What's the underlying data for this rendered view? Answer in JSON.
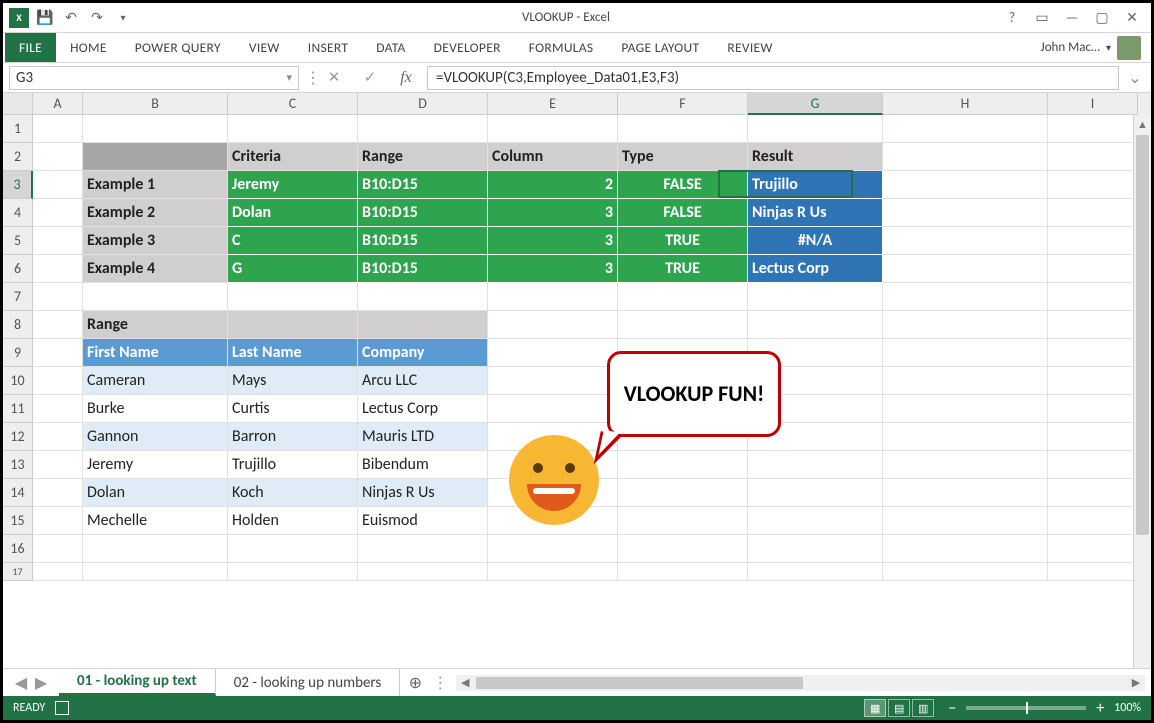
{
  "title": "VLOOKUP - Excel",
  "ribbon": {
    "file": "FILE",
    "tabs": [
      "HOME",
      "POWER QUERY",
      "VIEW",
      "INSERT",
      "DATA",
      "DEVELOPER",
      "FORMULAS",
      "PAGE LAYOUT",
      "REVIEW"
    ]
  },
  "user": "John Mac…",
  "namebox": "G3",
  "formula": "=VLOOKUP(C3,Employee_Data01,E3,F3)",
  "colHeaders": [
    "A",
    "B",
    "C",
    "D",
    "E",
    "F",
    "G",
    "H",
    "I"
  ],
  "activeCol": "G",
  "activeRow": 3,
  "headers2": {
    "C": "Criteria",
    "D": "Range",
    "E": "Column",
    "F": "Type",
    "G": "Result"
  },
  "examples": [
    {
      "label": "Example 1",
      "criteria": "Jeremy",
      "range": "B10:D15",
      "column": "2",
      "type": "FALSE",
      "result": "Trujillo"
    },
    {
      "label": "Example 2",
      "criteria": "Dolan",
      "range": "B10:D15",
      "column": "3",
      "type": "FALSE",
      "result": "Ninjas R Us"
    },
    {
      "label": "Example 3",
      "criteria": "C",
      "range": "B10:D15",
      "column": "3",
      "type": "TRUE",
      "result": "#N/A"
    },
    {
      "label": "Example 4",
      "criteria": "G",
      "range": "B10:D15",
      "column": "3",
      "type": "TRUE",
      "result": "Lectus Corp"
    }
  ],
  "rangeTitle": "Range",
  "rangeHeaders": {
    "first": "First Name",
    "last": "Last Name",
    "company": "Company"
  },
  "rangeData": [
    {
      "first": "Cameran",
      "last": "Mays",
      "company": "Arcu LLC"
    },
    {
      "first": "Burke",
      "last": "Curtis",
      "company": "Lectus Corp"
    },
    {
      "first": "Gannon",
      "last": "Barron",
      "company": "Mauris LTD"
    },
    {
      "first": "Jeremy",
      "last": "Trujillo",
      "company": "Bibendum"
    },
    {
      "first": "Dolan",
      "last": "Koch",
      "company": "Ninjas R Us"
    },
    {
      "first": "Mechelle",
      "last": "Holden",
      "company": "Euismod"
    }
  ],
  "callout": "VLOOKUP FUN!",
  "sheets": {
    "active": "01 - looking up text",
    "other": "02 - looking up numbers"
  },
  "status": {
    "ready": "READY",
    "zoom": "100%"
  }
}
